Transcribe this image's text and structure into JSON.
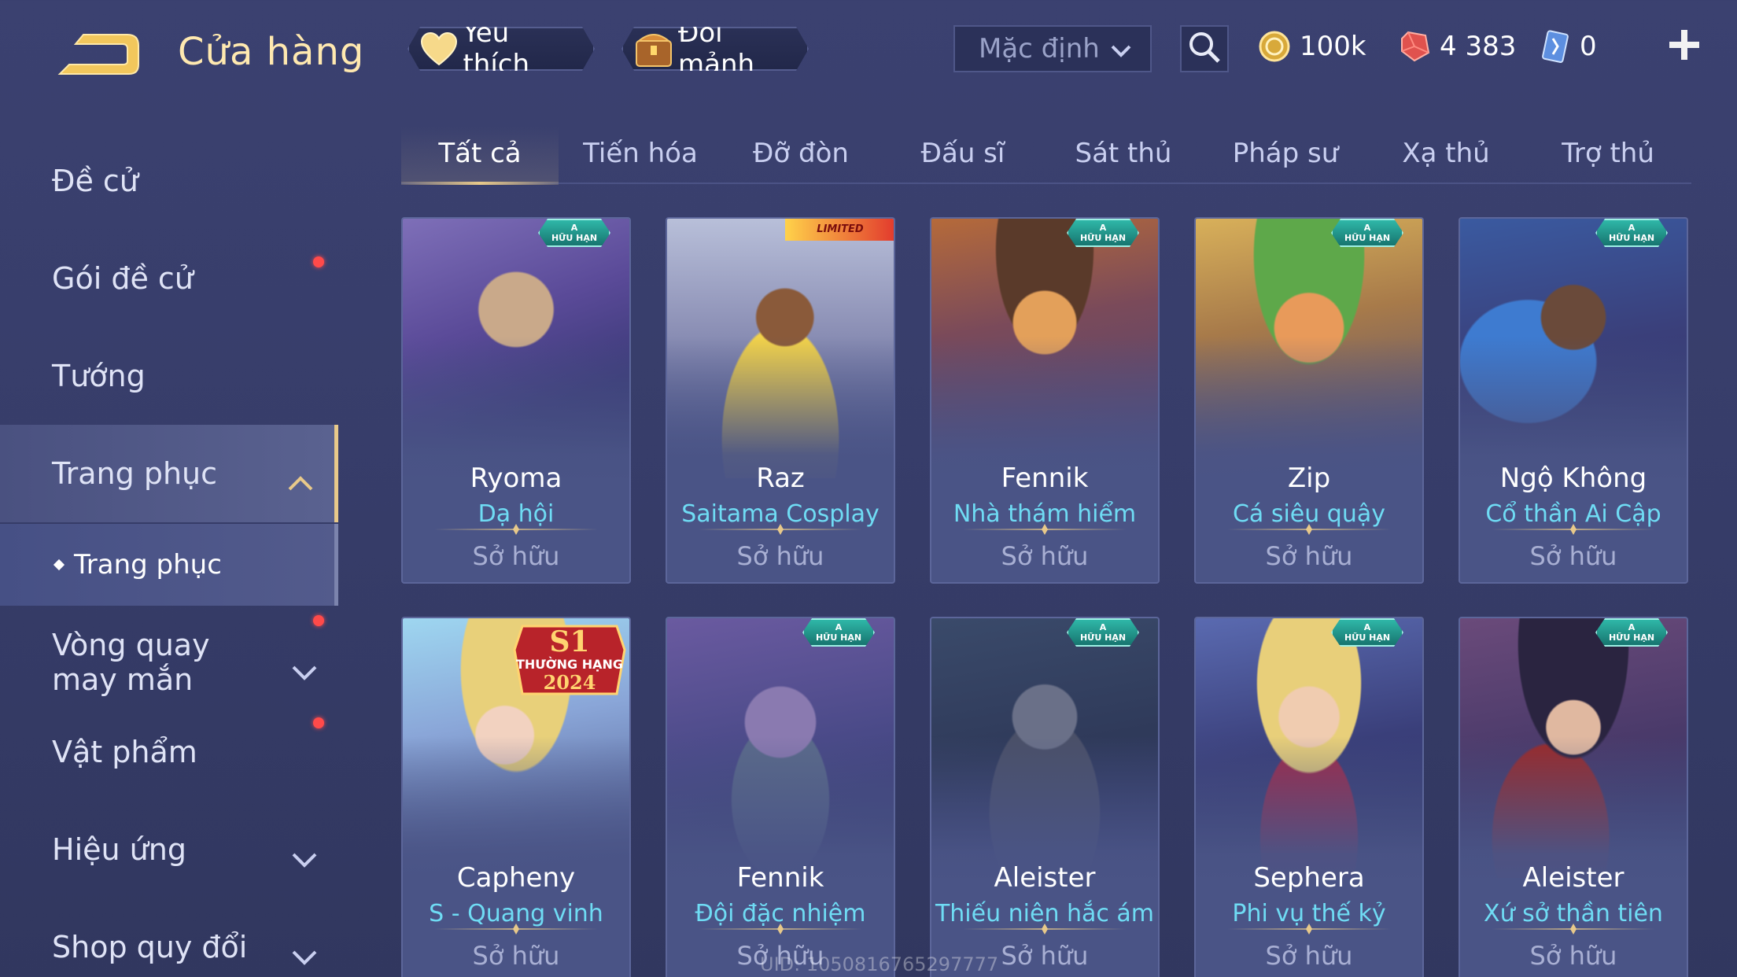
{
  "header": {
    "title": "Cửa hàng",
    "favorite_label": "Yêu thích",
    "exchange_label": "Đổi mảnh",
    "sort": {
      "selected": "Mặc định"
    },
    "currencies": {
      "gold": "100k",
      "gems": "4 383",
      "vouchers": "0"
    }
  },
  "sidebar": {
    "items": [
      {
        "label": "Đề cử",
        "dot": false
      },
      {
        "label": "Gói đề cử",
        "dot": true
      },
      {
        "label": "Tướng",
        "dot": false
      },
      {
        "label": "Trang phục",
        "dot": false
      },
      {
        "label": "Trang phục",
        "dot": false
      },
      {
        "label": "Vòng quay may mắn",
        "dot": true
      },
      {
        "label": "Vật phẩm",
        "dot": true
      },
      {
        "label": "Hiệu ứng",
        "dot": false
      },
      {
        "label": "Shop quy đổi",
        "dot": false
      }
    ]
  },
  "tabs": [
    "Tất cả",
    "Tiến hóa",
    "Đỡ đòn",
    "Đấu sĩ",
    "Sát thủ",
    "Pháp sư",
    "Xạ thủ",
    "Trợ thủ"
  ],
  "badges": {
    "limited_top": "A",
    "limited_bottom": "HỮU HẠN",
    "collab": "LIMITED",
    "rank_s1": "S1",
    "rank_label": "THƯỜNG HẠNG",
    "rank_year": "2024"
  },
  "cards": [
    {
      "hero": "Ryoma",
      "skin": "Dạ hội",
      "status": "Sở hữu"
    },
    {
      "hero": "Raz",
      "skin": "Saitama Cosplay",
      "status": "Sở hữu"
    },
    {
      "hero": "Fennik",
      "skin": "Nhà thám hiểm",
      "status": "Sở hữu"
    },
    {
      "hero": "Zip",
      "skin": "Cá siêu quậy",
      "status": "Sở hữu"
    },
    {
      "hero": "Ngộ Không",
      "skin": "Cổ thần Ai Cập",
      "status": "Sở hữu"
    },
    {
      "hero": "Capheny",
      "skin": "S - Quang vinh",
      "status": "Sở hữu"
    },
    {
      "hero": "Fennik",
      "skin": "Đội đặc nhiệm",
      "status": "Sở hữu"
    },
    {
      "hero": "Aleister",
      "skin": "Thiếu niên hắc ám",
      "status": "Sở hữu"
    },
    {
      "hero": "Sephera",
      "skin": "Phi vụ thế kỷ",
      "status": "Sở hữu"
    },
    {
      "hero": "Aleister",
      "skin": "Xứ sở thần tiên",
      "status": "Sở hữu"
    }
  ],
  "uid_text": "UID: 1050816765297777",
  "colors": {
    "accent_gold": "#e8c98a",
    "skin_name": "#6fdcf4",
    "notify_dot": "#ff4a4a",
    "badge_teal": "#2fb7a8"
  }
}
